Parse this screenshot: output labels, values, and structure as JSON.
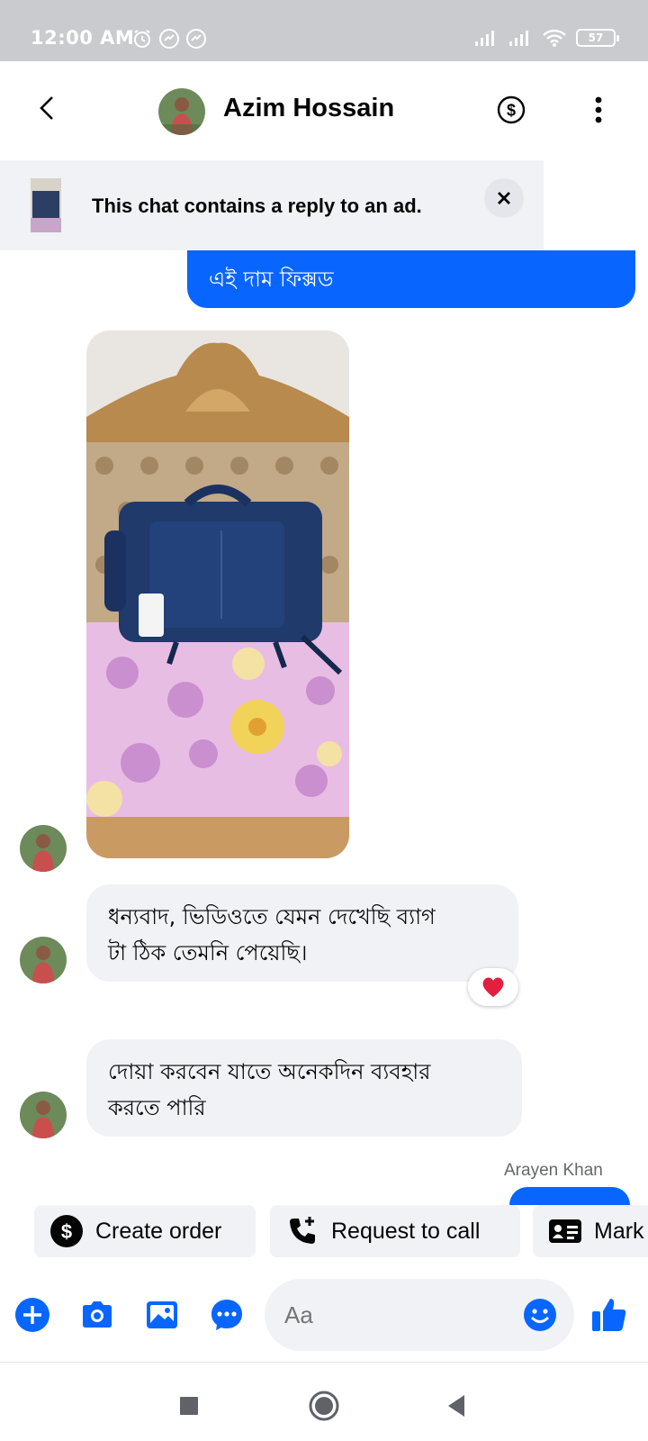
{
  "status_bar": {
    "time": "12:00 AM",
    "battery": "57"
  },
  "header": {
    "contact_name": "Azim Hossain"
  },
  "ad_banner": {
    "text": "This chat contains a reply to an ad."
  },
  "messages": {
    "outgoing_1": "এই দাম ফিক্সড",
    "incoming_1_line1": "ধন্যবাদ, ভিডিওতে যেমন দেখেছি ব্যাগ",
    "incoming_1_line2": "টা ঠিক তেমনি পেয়েছি।",
    "incoming_2_line1": "দোয়া করবেন যাতে অনেকদিন ব্যবহার",
    "incoming_2_line2": "করতে পারি",
    "seen_by": "Arayen Khan"
  },
  "quick_actions": [
    {
      "label": "Create order",
      "icon": "dollar-circle-icon"
    },
    {
      "label": "Request to call",
      "icon": "phone-plus-icon"
    },
    {
      "label": "Mark",
      "icon": "contact-card-icon"
    }
  ],
  "composer": {
    "placeholder": "Aa"
  },
  "colors": {
    "accent": "#0866ff",
    "bubble_in": "#f0f2f5",
    "status_bar": "#c9cbcf"
  }
}
